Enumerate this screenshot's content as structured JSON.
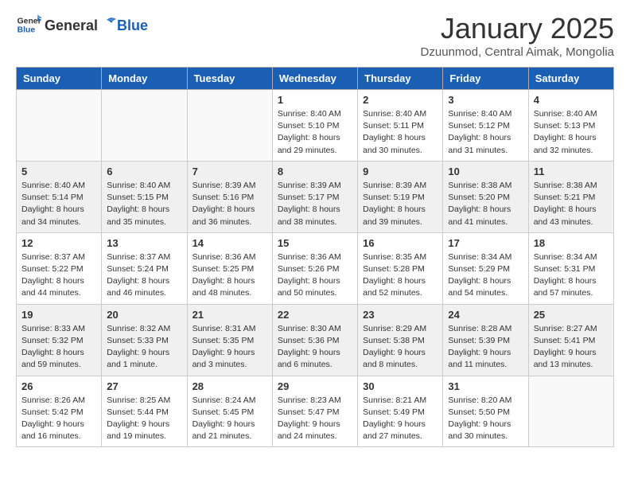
{
  "header": {
    "logo_general": "General",
    "logo_blue": "Blue",
    "title": "January 2025",
    "subtitle": "Dzuunmod, Central Aimak, Mongolia"
  },
  "weekdays": [
    "Sunday",
    "Monday",
    "Tuesday",
    "Wednesday",
    "Thursday",
    "Friday",
    "Saturday"
  ],
  "weeks": [
    [
      {
        "day": "",
        "info": ""
      },
      {
        "day": "",
        "info": ""
      },
      {
        "day": "",
        "info": ""
      },
      {
        "day": "1",
        "info": "Sunrise: 8:40 AM\nSunset: 5:10 PM\nDaylight: 8 hours\nand 29 minutes."
      },
      {
        "day": "2",
        "info": "Sunrise: 8:40 AM\nSunset: 5:11 PM\nDaylight: 8 hours\nand 30 minutes."
      },
      {
        "day": "3",
        "info": "Sunrise: 8:40 AM\nSunset: 5:12 PM\nDaylight: 8 hours\nand 31 minutes."
      },
      {
        "day": "4",
        "info": "Sunrise: 8:40 AM\nSunset: 5:13 PM\nDaylight: 8 hours\nand 32 minutes."
      }
    ],
    [
      {
        "day": "5",
        "info": "Sunrise: 8:40 AM\nSunset: 5:14 PM\nDaylight: 8 hours\nand 34 minutes."
      },
      {
        "day": "6",
        "info": "Sunrise: 8:40 AM\nSunset: 5:15 PM\nDaylight: 8 hours\nand 35 minutes."
      },
      {
        "day": "7",
        "info": "Sunrise: 8:39 AM\nSunset: 5:16 PM\nDaylight: 8 hours\nand 36 minutes."
      },
      {
        "day": "8",
        "info": "Sunrise: 8:39 AM\nSunset: 5:17 PM\nDaylight: 8 hours\nand 38 minutes."
      },
      {
        "day": "9",
        "info": "Sunrise: 8:39 AM\nSunset: 5:19 PM\nDaylight: 8 hours\nand 39 minutes."
      },
      {
        "day": "10",
        "info": "Sunrise: 8:38 AM\nSunset: 5:20 PM\nDaylight: 8 hours\nand 41 minutes."
      },
      {
        "day": "11",
        "info": "Sunrise: 8:38 AM\nSunset: 5:21 PM\nDaylight: 8 hours\nand 43 minutes."
      }
    ],
    [
      {
        "day": "12",
        "info": "Sunrise: 8:37 AM\nSunset: 5:22 PM\nDaylight: 8 hours\nand 44 minutes."
      },
      {
        "day": "13",
        "info": "Sunrise: 8:37 AM\nSunset: 5:24 PM\nDaylight: 8 hours\nand 46 minutes."
      },
      {
        "day": "14",
        "info": "Sunrise: 8:36 AM\nSunset: 5:25 PM\nDaylight: 8 hours\nand 48 minutes."
      },
      {
        "day": "15",
        "info": "Sunrise: 8:36 AM\nSunset: 5:26 PM\nDaylight: 8 hours\nand 50 minutes."
      },
      {
        "day": "16",
        "info": "Sunrise: 8:35 AM\nSunset: 5:28 PM\nDaylight: 8 hours\nand 52 minutes."
      },
      {
        "day": "17",
        "info": "Sunrise: 8:34 AM\nSunset: 5:29 PM\nDaylight: 8 hours\nand 54 minutes."
      },
      {
        "day": "18",
        "info": "Sunrise: 8:34 AM\nSunset: 5:31 PM\nDaylight: 8 hours\nand 57 minutes."
      }
    ],
    [
      {
        "day": "19",
        "info": "Sunrise: 8:33 AM\nSunset: 5:32 PM\nDaylight: 8 hours\nand 59 minutes."
      },
      {
        "day": "20",
        "info": "Sunrise: 8:32 AM\nSunset: 5:33 PM\nDaylight: 9 hours\nand 1 minute."
      },
      {
        "day": "21",
        "info": "Sunrise: 8:31 AM\nSunset: 5:35 PM\nDaylight: 9 hours\nand 3 minutes."
      },
      {
        "day": "22",
        "info": "Sunrise: 8:30 AM\nSunset: 5:36 PM\nDaylight: 9 hours\nand 6 minutes."
      },
      {
        "day": "23",
        "info": "Sunrise: 8:29 AM\nSunset: 5:38 PM\nDaylight: 9 hours\nand 8 minutes."
      },
      {
        "day": "24",
        "info": "Sunrise: 8:28 AM\nSunset: 5:39 PM\nDaylight: 9 hours\nand 11 minutes."
      },
      {
        "day": "25",
        "info": "Sunrise: 8:27 AM\nSunset: 5:41 PM\nDaylight: 9 hours\nand 13 minutes."
      }
    ],
    [
      {
        "day": "26",
        "info": "Sunrise: 8:26 AM\nSunset: 5:42 PM\nDaylight: 9 hours\nand 16 minutes."
      },
      {
        "day": "27",
        "info": "Sunrise: 8:25 AM\nSunset: 5:44 PM\nDaylight: 9 hours\nand 19 minutes."
      },
      {
        "day": "28",
        "info": "Sunrise: 8:24 AM\nSunset: 5:45 PM\nDaylight: 9 hours\nand 21 minutes."
      },
      {
        "day": "29",
        "info": "Sunrise: 8:23 AM\nSunset: 5:47 PM\nDaylight: 9 hours\nand 24 minutes."
      },
      {
        "day": "30",
        "info": "Sunrise: 8:21 AM\nSunset: 5:49 PM\nDaylight: 9 hours\nand 27 minutes."
      },
      {
        "day": "31",
        "info": "Sunrise: 8:20 AM\nSunset: 5:50 PM\nDaylight: 9 hours\nand 30 minutes."
      },
      {
        "day": "",
        "info": ""
      }
    ]
  ]
}
